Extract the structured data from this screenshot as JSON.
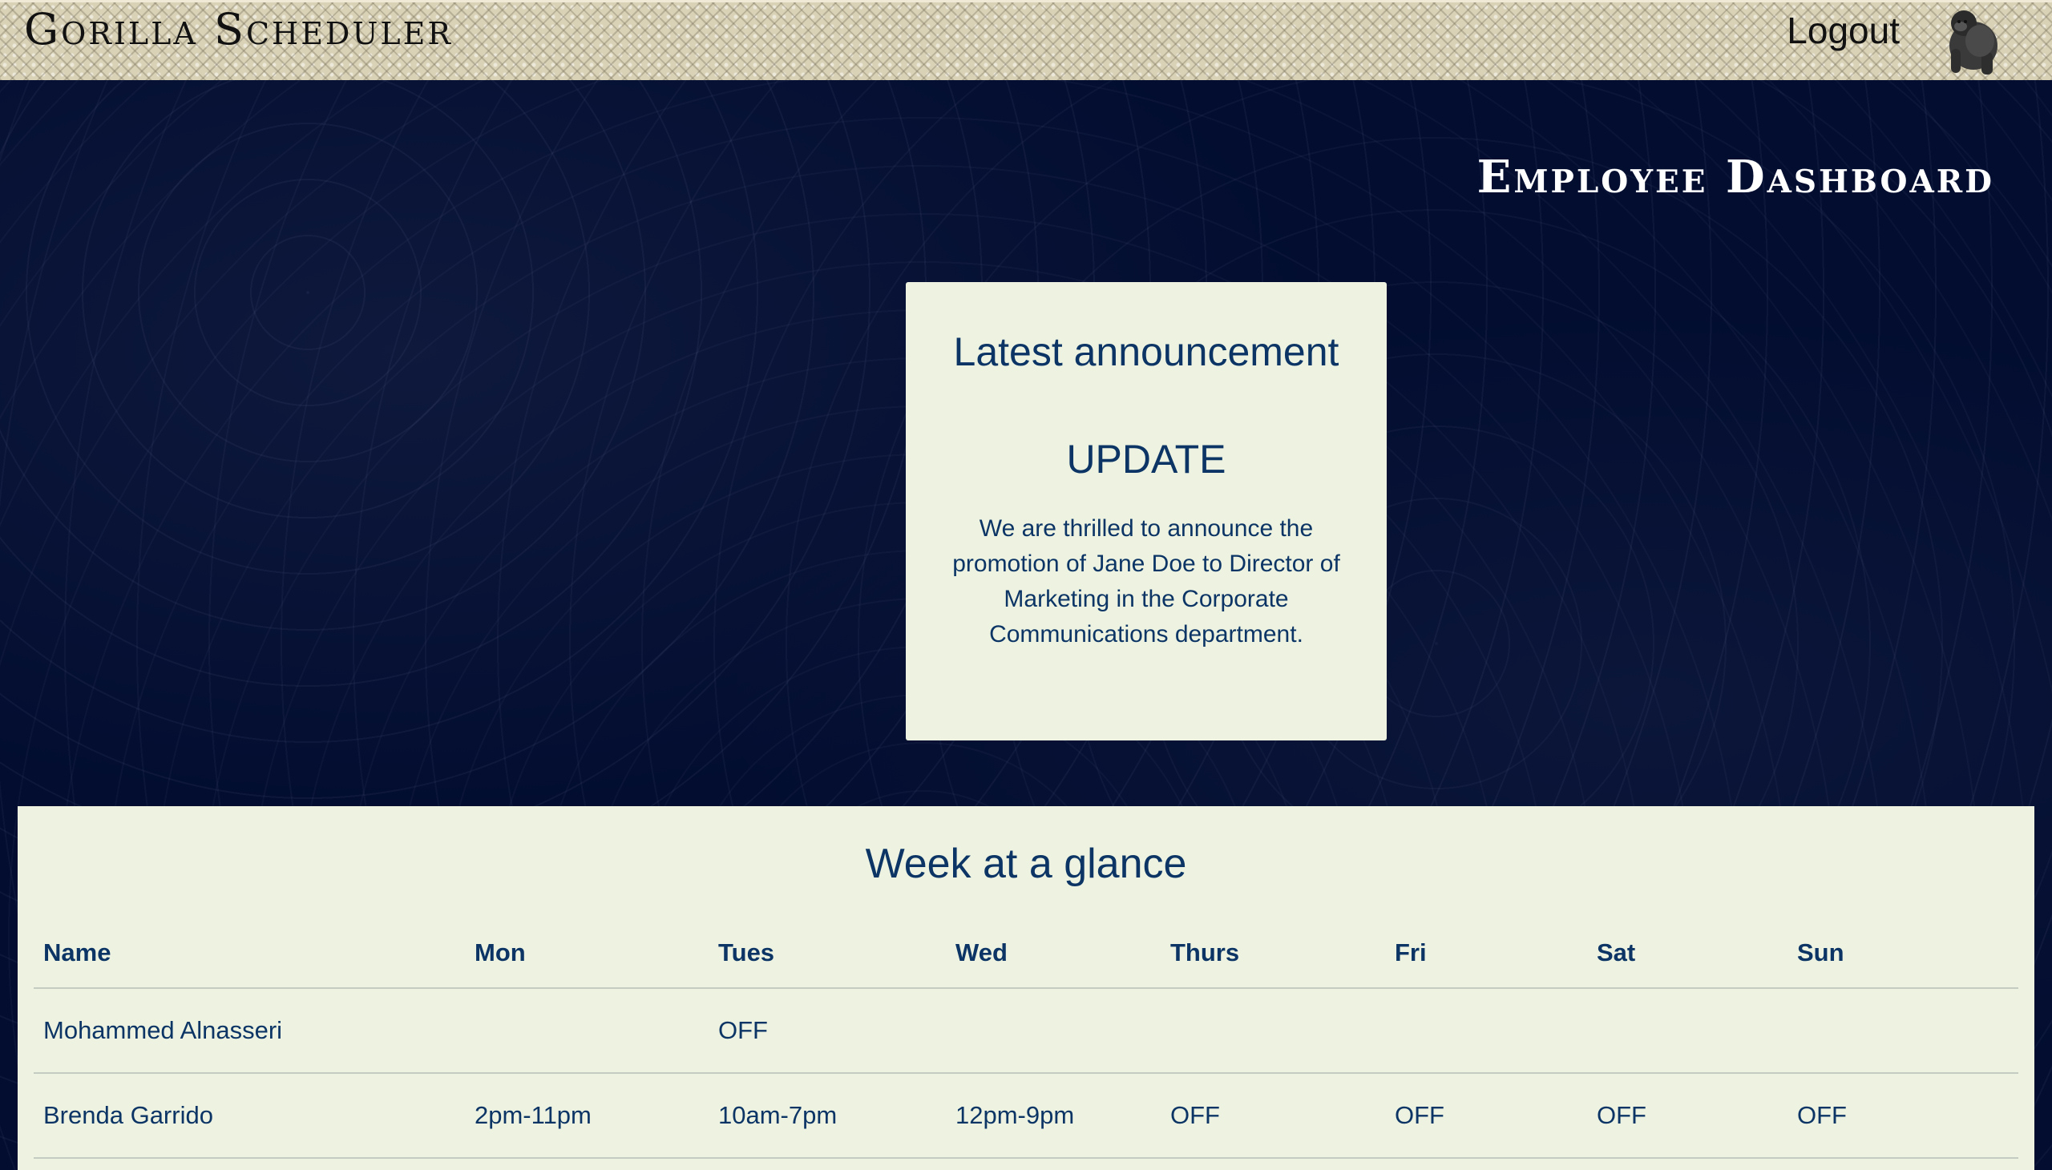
{
  "header": {
    "app_title": "Gorilla Scheduler",
    "logout_label": "Logout",
    "logo_icon": "gorilla-icon"
  },
  "dashboard": {
    "title": "Employee Dashboard"
  },
  "announcement": {
    "heading": "Latest announcement",
    "subject": "UPDATE",
    "body": "We are thrilled to announce the promotion of Jane Doe to Director of Marketing in the Corporate Communications department."
  },
  "week": {
    "title": "Week at a glance",
    "columns": [
      "Name",
      "Mon",
      "Tues",
      "Wed",
      "Thurs",
      "Fri",
      "Sat",
      "Sun"
    ],
    "rows": [
      [
        "Mohammed Alnasseri",
        "",
        "OFF",
        "",
        "",
        "",
        "",
        ""
      ],
      [
        "Brenda Garrido",
        "2pm-11pm",
        "10am-7pm",
        "12pm-9pm",
        "OFF",
        "OFF",
        "OFF",
        "OFF"
      ]
    ]
  },
  "colors": {
    "page_background": "#020d30",
    "panel_background": "#edf3e0",
    "text_primary": "#0c3566",
    "topbar_background": "#d9d2b6"
  }
}
